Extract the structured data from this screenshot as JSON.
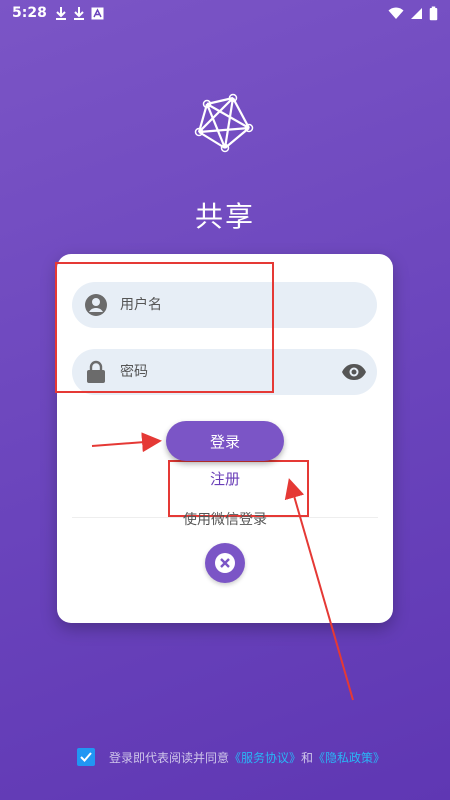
{
  "status_bar": {
    "time": "5:28"
  },
  "app": {
    "title": "共享"
  },
  "login": {
    "username_placeholder": "用户名",
    "password_placeholder": "密码",
    "login_label": "登录",
    "register_label": "注册",
    "wechat_label": "使用微信登录"
  },
  "agreement": {
    "text_prefix": "登录即代表阅读并同意",
    "service_link": "《服务协议》",
    "and": "和",
    "privacy_link": "《隐私政策》",
    "checked": true
  },
  "colors": {
    "background": "#6a44bc",
    "primary": "#7b55c6",
    "link": "#29b6f6",
    "annotation": "#e53935"
  },
  "icons": {
    "status": [
      "download-icon",
      "download-icon",
      "text-icon",
      "wifi-icon",
      "signal-icon",
      "battery-icon"
    ],
    "logo": "network-graph-icon",
    "user_field": "account-circle-icon",
    "password_field": "lock-icon",
    "password_toggle": "eye-icon",
    "close": "close-icon",
    "checkbox": "check-icon"
  }
}
